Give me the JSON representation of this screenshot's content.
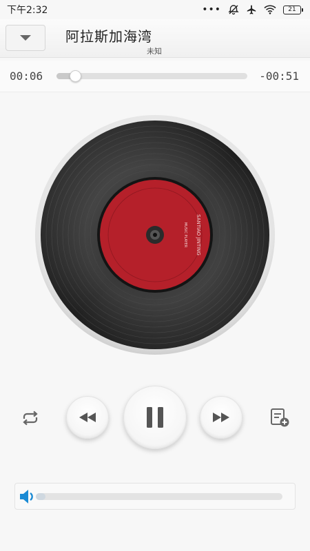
{
  "status_bar": {
    "time": "下午2:32",
    "battery": "21"
  },
  "header": {
    "title": "阿拉斯加海湾",
    "artist": "未知"
  },
  "progress": {
    "elapsed": "00:06",
    "remaining": "-00:51",
    "fraction": 0.1
  },
  "record": {
    "label_color": "#b5202a",
    "label_text_top": "SANTIAO JINTING",
    "label_text_mid": "MUSIC PLAYER"
  },
  "controls": {
    "repeat_icon": "repeat-icon",
    "prev_icon": "rewind-icon",
    "play_state_icon": "pause-icon",
    "next_icon": "fast-forward-icon",
    "playlist_icon": "add-to-playlist-icon"
  },
  "volume": {
    "level": 0.04,
    "icon": "speaker-icon",
    "accent": "#1a8ad4"
  }
}
